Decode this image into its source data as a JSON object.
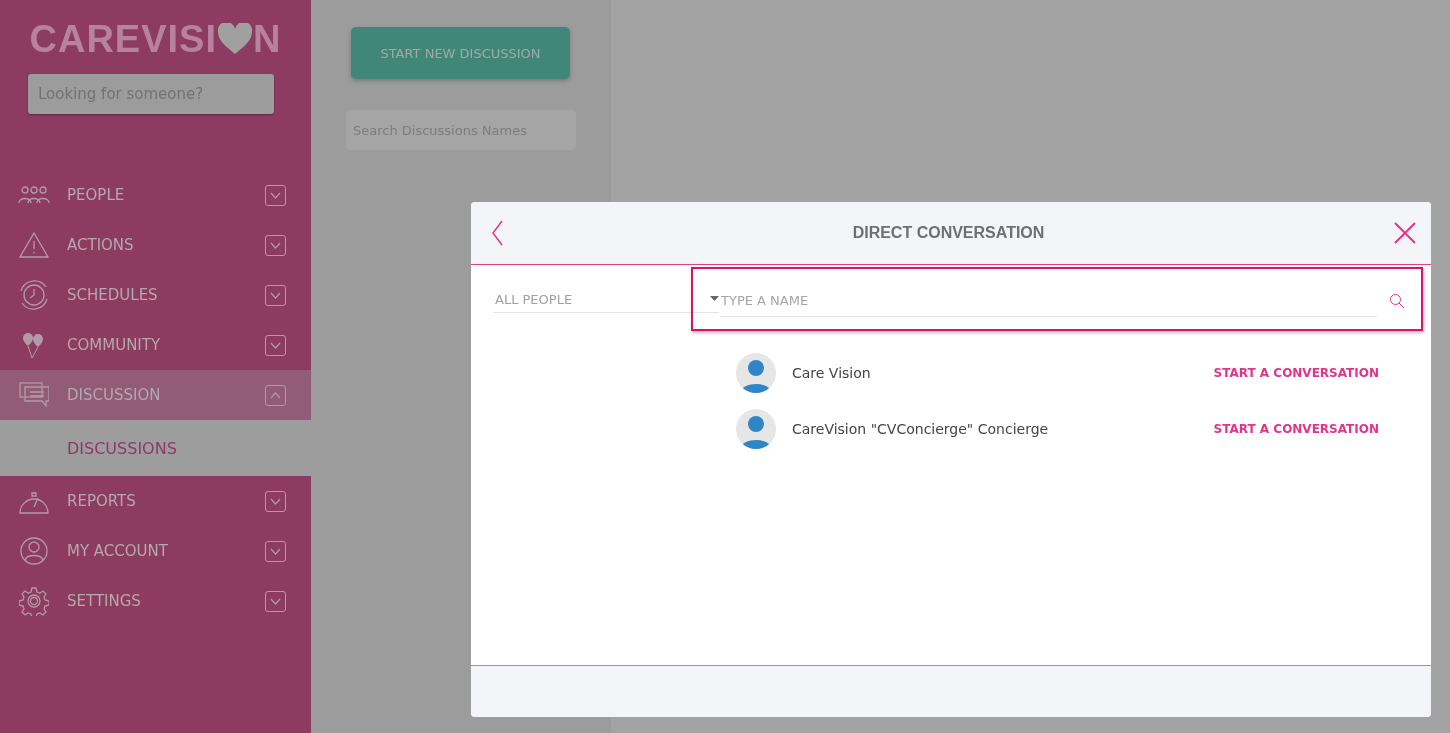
{
  "sidebar": {
    "logo": {
      "before_heart": "CAREVISI",
      "after_heart": "N"
    },
    "search": {
      "placeholder": "Looking for someone?"
    },
    "items": [
      {
        "label": "PEOPLE",
        "expanded": false
      },
      {
        "label": "ACTIONS",
        "expanded": false
      },
      {
        "label": "SCHEDULES",
        "expanded": false
      },
      {
        "label": "COMMUNITY",
        "expanded": false
      },
      {
        "label": "DISCUSSION",
        "expanded": true,
        "children": [
          {
            "label": "DISCUSSIONS",
            "selected": true
          }
        ]
      },
      {
        "label": "REPORTS",
        "expanded": false
      },
      {
        "label": "MY ACCOUNT",
        "expanded": false
      },
      {
        "label": "SETTINGS",
        "expanded": false
      }
    ]
  },
  "discussions_panel": {
    "new_button": "START NEW DISCUSSION",
    "search": {
      "placeholder": "Search Discussions Names"
    }
  },
  "dialog": {
    "title": "DIRECT CONVERSATION",
    "filter": {
      "value": "ALL PEOPLE"
    },
    "name_search": {
      "placeholder": "TYPE A NAME"
    },
    "contacts": [
      {
        "name": "Care Vision",
        "action": "START A CONVERSATION"
      },
      {
        "name": "CareVision \"CVConcierge\" Concierge",
        "action": "START A CONVERSATION"
      }
    ]
  }
}
